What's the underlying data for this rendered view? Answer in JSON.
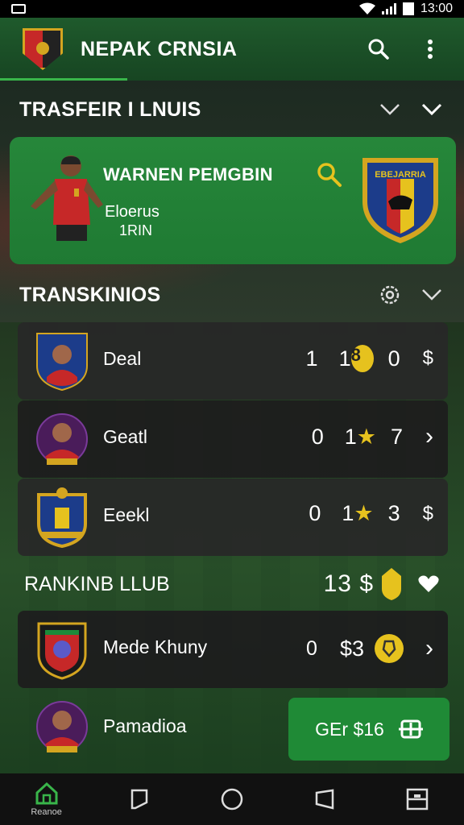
{
  "status_bar": {
    "time": "13:00"
  },
  "app_bar": {
    "title": "NEPAK CRNSIA"
  },
  "section_transfer": {
    "title": "TRASFEIR I LNUIS"
  },
  "feature": {
    "name": "WARNEN PEMGBIN",
    "sub1": "Eloerus",
    "sub2": "1RIN",
    "badge_text": "EBEJARRIA"
  },
  "section_transactions": {
    "title": "TRANSKINIOS"
  },
  "rows": [
    {
      "label": "Deal",
      "v1": "1",
      "v2": "1",
      "coin": "8",
      "v3": "0",
      "end": "$"
    },
    {
      "label": "Geatl",
      "v1": "0",
      "v2": "1",
      "coin": "★",
      "v3": "7",
      "end": "›"
    },
    {
      "label": "Eeekl",
      "v1": "0",
      "v2": "1",
      "coin": "★",
      "v3": "3",
      "end": "$"
    }
  ],
  "ranking": {
    "title": "RANKINB LLUB",
    "count": "13 $"
  },
  "club_rows": [
    {
      "label": "Mede Khuny",
      "v1": "0",
      "v2": "$3",
      "end": "›"
    },
    {
      "label": "Pamadioa"
    }
  ],
  "cta": {
    "label": "GEr $16"
  },
  "bottom_nav": {
    "home_label": "Reanoe"
  },
  "colors": {
    "brand_green": "#1f7a33",
    "coin": "#e6c21e",
    "accent": "#39b54a"
  }
}
